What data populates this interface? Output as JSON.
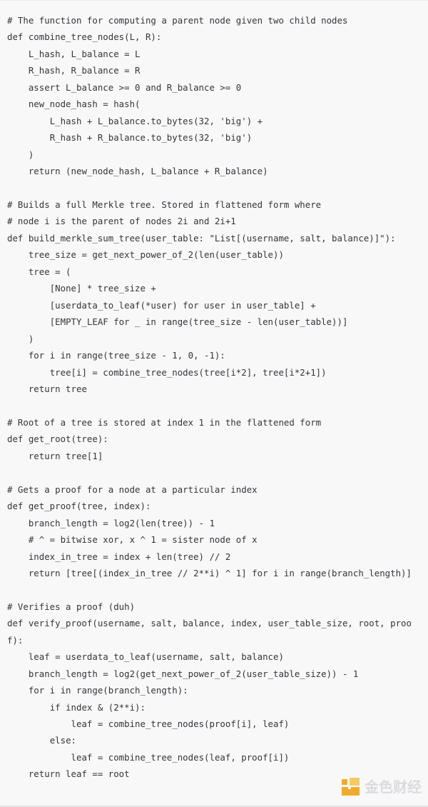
{
  "panel": {
    "background_color": "#f8f8f9",
    "text_color": "#333538",
    "language": "python"
  },
  "code": {
    "content": "# The function for computing a parent node given two child nodes\ndef combine_tree_nodes(L, R):\n    L_hash, L_balance = L\n    R_hash, R_balance = R\n    assert L_balance >= 0 and R_balance >= 0\n    new_node_hash = hash(\n        L_hash + L_balance.to_bytes(32, 'big') +\n        R_hash + R_balance.to_bytes(32, 'big')\n    )\n    return (new_node_hash, L_balance + R_balance)\n\n# Builds a full Merkle tree. Stored in flattened form where\n# node i is the parent of nodes 2i and 2i+1\ndef build_merkle_sum_tree(user_table: \"List[(username, salt, balance)]\"):\n    tree_size = get_next_power_of_2(len(user_table))\n    tree = (\n        [None] * tree_size +\n        [userdata_to_leaf(*user) for user in user_table] +\n        [EMPTY_LEAF for _ in range(tree_size - len(user_table))]\n    )\n    for i in range(tree_size - 1, 0, -1):\n        tree[i] = combine_tree_nodes(tree[i*2], tree[i*2+1])\n    return tree\n\n# Root of a tree is stored at index 1 in the flattened form\ndef get_root(tree):\n    return tree[1]\n\n# Gets a proof for a node at a particular index\ndef get_proof(tree, index):\n    branch_length = log2(len(tree)) - 1\n    # ^ = bitwise xor, x ^ 1 = sister node of x\n    index_in_tree = index + len(tree) // 2\n    return [tree[(index_in_tree // 2**i) ^ 1] for i in range(branch_length)]\n\n# Verifies a proof (duh)\ndef verify_proof(username, salt, balance, index, user_table_size, root, proof):\n    leaf = userdata_to_leaf(username, salt, balance)\n    branch_length = log2(get_next_power_of_2(user_table_size)) - 1\n    for i in range(branch_length):\n        if index & (2**i):\n            leaf = combine_tree_nodes(proof[i], leaf)\n        else:\n            leaf = combine_tree_nodes(leaf, proof[i])\n    return leaf == root"
  },
  "watermark": {
    "text": "金色财经",
    "logo_color_primary": "#f0a722",
    "logo_color_secondary": "#f6c85a",
    "text_color": "#d9dadc"
  }
}
